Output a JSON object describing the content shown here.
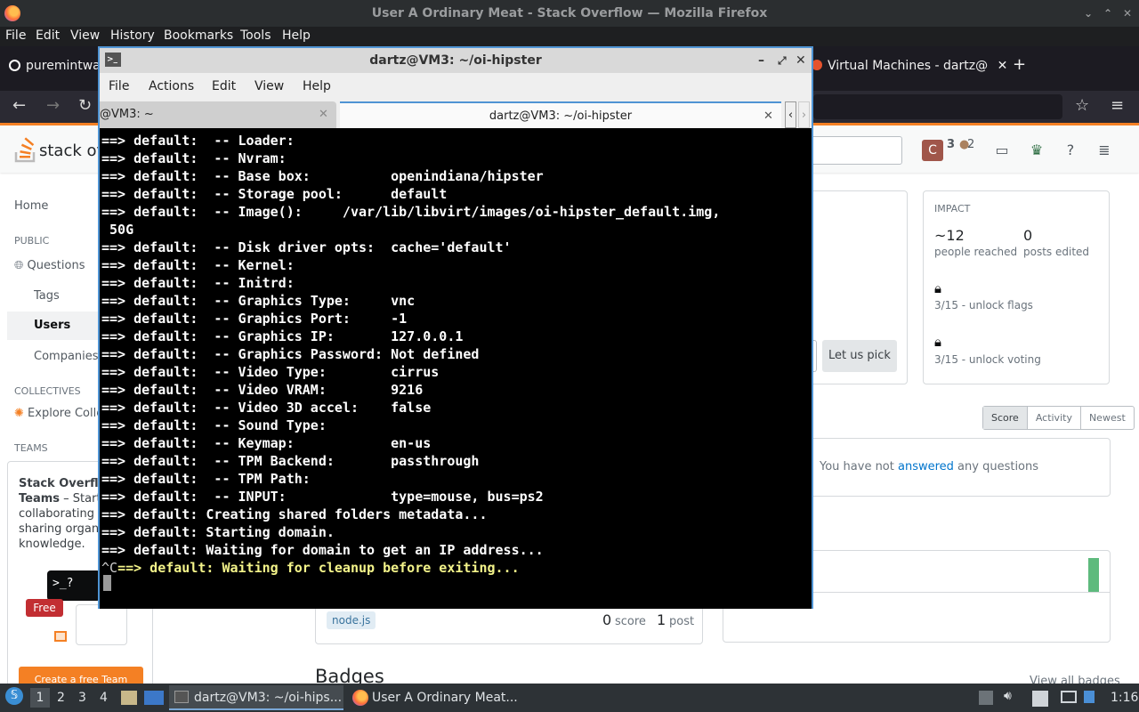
{
  "firefox": {
    "window_title": "User A Ordinary Meat - Stack Overflow — Mozilla Firefox",
    "menu": [
      "File",
      "Edit",
      "View",
      "History",
      "Bookmarks",
      "Tools",
      "Help"
    ],
    "tabs": [
      {
        "label": "puremintwa"
      },
      {
        "label": "Virtual Machines - dartz@"
      }
    ],
    "new_tab_symbol": "+",
    "nav": {
      "back": "←",
      "forward": "→",
      "reload": "↻",
      "bookmark": "☆",
      "menu": "≡"
    }
  },
  "so": {
    "logo_text": "stack ove",
    "avatar_letter": "C",
    "reputation": "3",
    "bronze": "2",
    "leftnav": {
      "home": "Home",
      "public_label": "PUBLIC",
      "questions": "Questions",
      "tags": "Tags",
      "users": "Users",
      "companies": "Companies",
      "collectives_label": "COLLECTIVES",
      "explore": "Explore Colle",
      "teams_label": "TEAMS",
      "teams_title": "Stack Overflow",
      "teams_title2": "Teams",
      "teams_text1": " – Start",
      "teams_text2": "collaborating ar",
      "teams_text3": "sharing organiz",
      "teams_text4": "knowledge.",
      "free_badge": "Free",
      "prompt_glyph": ">_?",
      "create_team": "Create a free Team"
    },
    "impact": {
      "title": "IMPACT",
      "people_value": "~12",
      "people_label": "people reached",
      "posts_value": "0",
      "posts_label": "posts edited",
      "unlock_flags": "3/15 - unlock flags",
      "unlock_voting": "3/15 - unlock voting"
    },
    "let_us_pick": "Let us pick",
    "sort": [
      "Score",
      "Activity",
      "Newest"
    ],
    "answers_text_pre": "You have not ",
    "answers_link": "answered",
    "answers_text_post": " any questions",
    "tag": "node.js",
    "score_value": "0",
    "score_label": "score",
    "post_value": "1",
    "post_label": "post",
    "badges_heading": "Badges",
    "view_all_badges": "View all badges"
  },
  "terminal": {
    "title": "dartz@VM3: ~/oi-hipster",
    "menu": [
      "File",
      "Actions",
      "Edit",
      "View",
      "Help"
    ],
    "tabs": [
      {
        "label": "@VM3: ~"
      },
      {
        "label": "dartz@VM3: ~/oi-hipster"
      }
    ],
    "lines": [
      "==> default:  -- Loader:",
      "==> default:  -- Nvram:",
      "==> default:  -- Base box:          openindiana/hipster",
      "==> default:  -- Storage pool:      default",
      "==> default:  -- Image():     /var/lib/libvirt/images/oi-hipster_default.img,",
      " 50G",
      "==> default:  -- Disk driver opts:  cache='default'",
      "==> default:  -- Kernel:",
      "==> default:  -- Initrd:",
      "==> default:  -- Graphics Type:     vnc",
      "==> default:  -- Graphics Port:     -1",
      "==> default:  -- Graphics IP:       127.0.0.1",
      "==> default:  -- Graphics Password: Not defined",
      "==> default:  -- Video Type:        cirrus",
      "==> default:  -- Video VRAM:        9216",
      "==> default:  -- Video 3D accel:    false",
      "==> default:  -- Sound Type:",
      "==> default:  -- Keymap:            en-us",
      "==> default:  -- TPM Backend:       passthrough",
      "==> default:  -- TPM Path:",
      "==> default:  -- INPUT:             type=mouse, bus=ps2",
      "==> default: Creating shared folders metadata...",
      "==> default: Starting domain.",
      "==> default: Waiting for domain to get an IP address..."
    ],
    "interrupt_prefix": "^C",
    "last_line": "==> default: Waiting for cleanup before exiting...",
    "last_line_color": "#f4f48a"
  },
  "taskbar": {
    "workspaces": [
      "1",
      "2",
      "3",
      "4"
    ],
    "task1": "dartz@VM3: ~/oi-hips...",
    "task2": "User A Ordinary Meat...",
    "clock": "1:16"
  }
}
